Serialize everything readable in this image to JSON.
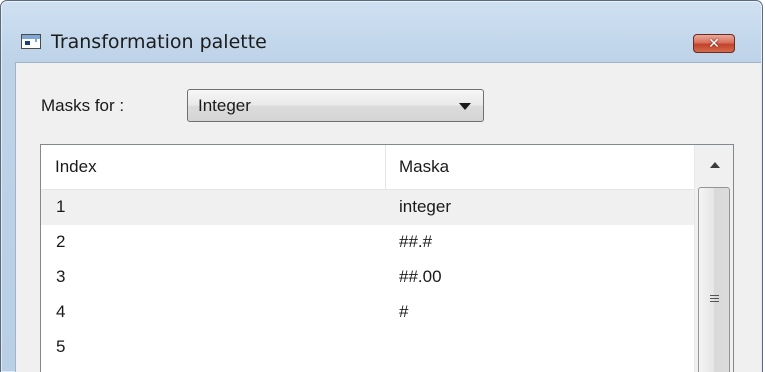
{
  "window": {
    "title": "Transformation palette",
    "close_label": "✕",
    "icon": "app-window-icon"
  },
  "masks": {
    "label": "Masks for :",
    "selected": "Integer"
  },
  "table": {
    "columns": [
      "Index",
      "Maska"
    ],
    "rows": [
      {
        "index": "1",
        "mask": "integer",
        "selected": true
      },
      {
        "index": "2",
        "mask": "##.#"
      },
      {
        "index": "3",
        "mask": "##.00"
      },
      {
        "index": "4",
        "mask": "#"
      },
      {
        "index": "5",
        "mask": ""
      }
    ]
  },
  "colors": {
    "title_bar": "#c3d7ec",
    "client_bg": "#f0f0f0",
    "close_button": "#c2432b",
    "selected_row": "#f0f0f0"
  }
}
